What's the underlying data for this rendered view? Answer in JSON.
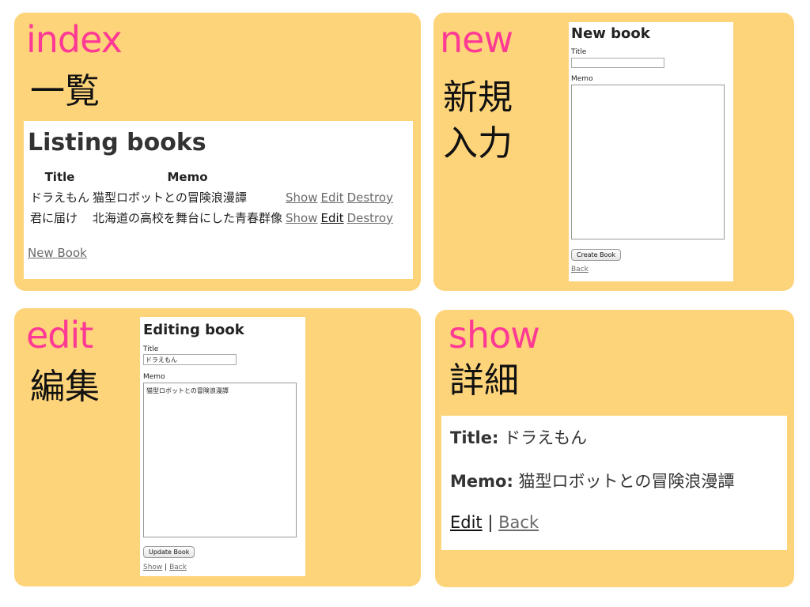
{
  "index": {
    "heading": "index",
    "kanji": "一覧",
    "title": "Listing books",
    "columns": [
      "Title",
      "Memo"
    ],
    "rows": [
      {
        "title": "ドラえもん",
        "memo": "猫型ロボットとの冒険浪漫譚"
      },
      {
        "title": "君に届け",
        "memo": "北海道の高校を舞台にした青春群像"
      }
    ],
    "actions": {
      "show": "Show",
      "edit": "Edit",
      "destroy": "Destroy"
    },
    "new_link": "New Book"
  },
  "new": {
    "heading": "new",
    "kanji_line1": "新規",
    "kanji_line2": "入力",
    "title": "New book",
    "title_label": "Title",
    "title_value": "",
    "memo_label": "Memo",
    "memo_value": "",
    "button": "Create Book",
    "back": "Back"
  },
  "edit": {
    "heading": "edit",
    "kanji": "編集",
    "title": "Editing book",
    "title_label": "Title",
    "title_value": "ドラえもん",
    "memo_label": "Memo",
    "memo_value": "猫型ロボットとの冒険浪漫譚",
    "button": "Update Book",
    "show_link": "Show",
    "separator": "|",
    "back": "Back"
  },
  "show": {
    "heading": "show",
    "kanji": "詳細",
    "title_label": "Title:",
    "title_value": "ドラえもん",
    "memo_label": "Memo:",
    "memo_value": "猫型ロボットとの冒険浪漫譚",
    "edit_link": "Edit",
    "separator": "|",
    "back_link": "Back"
  },
  "colors": {
    "panel": "#fed47a",
    "accent": "#ff3a94"
  }
}
